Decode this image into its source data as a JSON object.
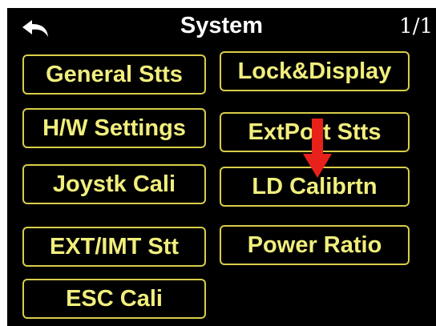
{
  "header": {
    "title": "System",
    "page_indicator": "1/1"
  },
  "menu": {
    "items": [
      {
        "label": "General Stts"
      },
      {
        "label": "Lock&Display"
      },
      {
        "label": "H/W Settings"
      },
      {
        "label": "ExtPort Stts"
      },
      {
        "label": "Joystk Cali"
      },
      {
        "label": "LD Calibrtn"
      },
      {
        "label": "EXT/IMT Stt"
      },
      {
        "label": "Power Ratio"
      },
      {
        "label": "ESC Cali"
      }
    ]
  },
  "annotation": {
    "arrow_color": "#e8221b",
    "icon": "down-arrow-icon"
  },
  "colors": {
    "background": "#000000",
    "button_border": "#d9cd49",
    "button_text": "#f1ee7d",
    "title_text": "#ffffff"
  }
}
